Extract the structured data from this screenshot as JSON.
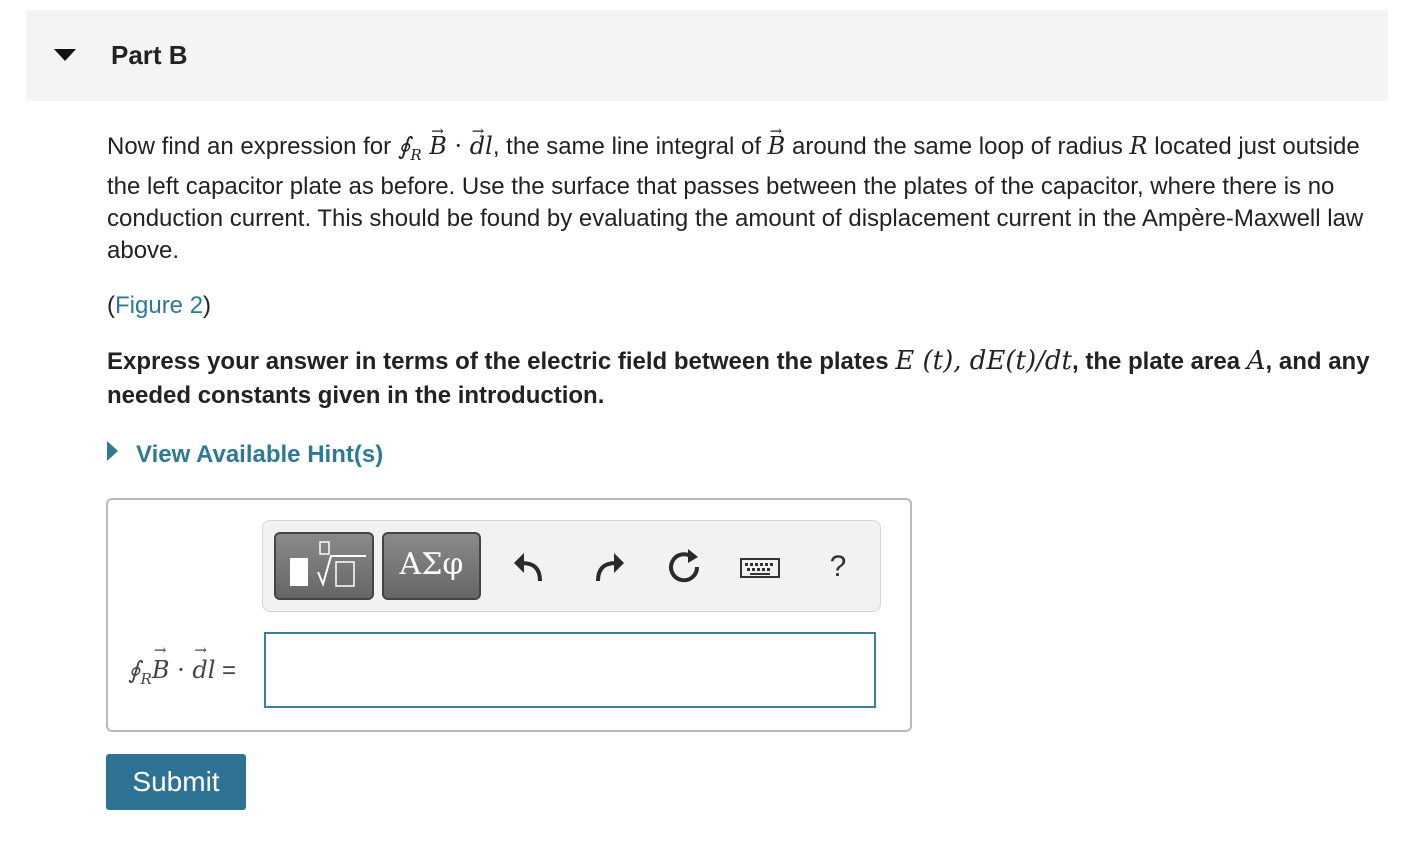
{
  "header": {
    "title": "Part B"
  },
  "question": {
    "p1": "Now find an expression for ",
    "integral_symbol": "∮",
    "integral_sub": "R",
    "b_symbol": "B",
    "dot": " · ",
    "dl_symbol": "dl",
    "p2": ", the same line integral of ",
    "p3": " around the same loop of radius ",
    "r_symbol": "R",
    "p4": " located just outside the left capacitor plate as before. Use the surface that passes between the plates of the capacitor, where there is no conduction current. This should be found by evaluating the amount of displacement current in the Ampère-Maxwell law above."
  },
  "figure": {
    "open": "(",
    "link": "Figure 2",
    "close": ")"
  },
  "instruction": {
    "t1": "Express your answer in terms of the electric field between the plates ",
    "m1": "E (t), dE(t)/dt",
    "t2": ", the plate area ",
    "m2": "A",
    "t3": ", and any needed constants given in the introduction."
  },
  "hint": {
    "label": "View Available Hint(s)"
  },
  "toolbar": {
    "greek_label": "ΑΣφ",
    "undo_icon": "undo-icon",
    "redo_icon": "redo-icon",
    "reset_icon": "reset-icon",
    "keyboard_icon": "keyboard-icon",
    "help_label": "?"
  },
  "answer": {
    "label_integral": "∮",
    "label_sub": "R",
    "label_b": "B",
    "label_dot": " · ",
    "label_dl": "dl",
    "label_equals": " =",
    "value": ""
  },
  "submit": {
    "label": "Submit"
  },
  "colors": {
    "link": "#2f7a93",
    "button": "#2f7394",
    "input_border": "#3a7ea0"
  }
}
